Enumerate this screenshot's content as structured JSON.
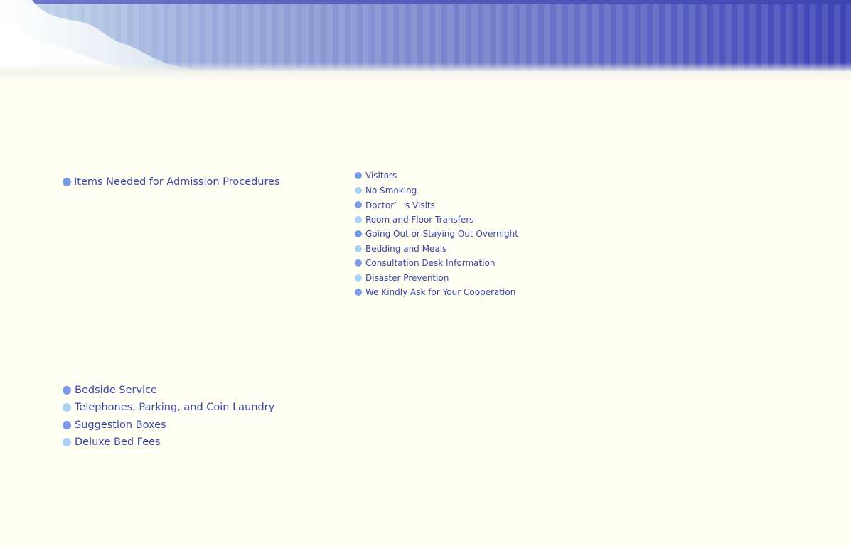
{
  "banner": {
    "icon": "striped-gradient-banner"
  },
  "admission_list": {
    "items": [
      {
        "label": "Items Needed for Admission Procedures",
        "bullet": "blue"
      }
    ]
  },
  "hospital_life_list": {
    "items": [
      {
        "label": "Visitors",
        "bullet": "blue"
      },
      {
        "label": "No Smoking",
        "bullet": "light"
      },
      {
        "label": "Doctor’　s Visits",
        "bullet": "blue"
      },
      {
        "label": "Room and Floor Transfers",
        "bullet": "light"
      },
      {
        "label": "Going Out or Staying Out Overnight",
        "bullet": "blue"
      },
      {
        "label": "Bedding and Meals",
        "bullet": "light"
      },
      {
        "label": "Consultation Desk Information",
        "bullet": "blue"
      },
      {
        "label": "Disaster Prevention",
        "bullet": "light"
      },
      {
        "label": "We Kindly Ask for Your Cooperation",
        "bullet": "blue"
      }
    ]
  },
  "services_list": {
    "items": [
      {
        "label": "Bedside Service",
        "bullet": "blue"
      },
      {
        "label": "Telephones, Parking, and Coin Laundry",
        "bullet": "light"
      },
      {
        "label": "Suggestion Boxes",
        "bullet": "blue"
      },
      {
        "label": "Deluxe Bed Fees",
        "bullet": "light"
      }
    ]
  },
  "colors": {
    "background": "#fffff4",
    "text": "#3d45a8",
    "bullet_blue": "#7f9ae6",
    "bullet_light": "#a8d2f3"
  }
}
